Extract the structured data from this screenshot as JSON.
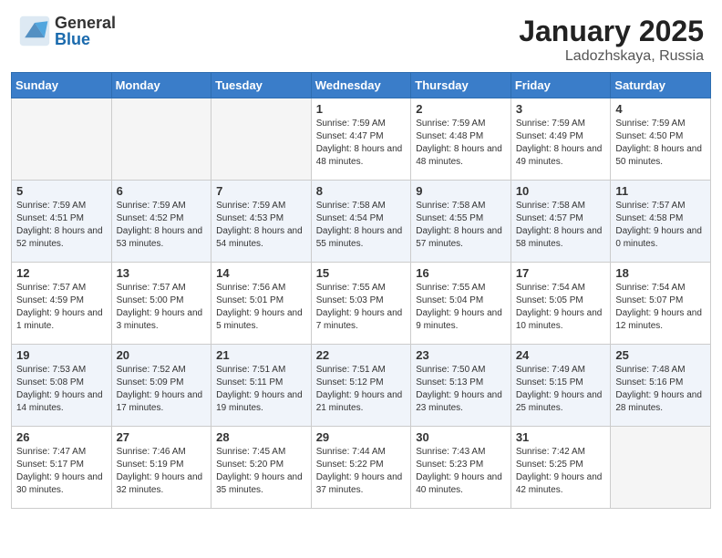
{
  "logo": {
    "general": "General",
    "blue": "Blue"
  },
  "header": {
    "month": "January 2025",
    "location": "Ladozhskaya, Russia"
  },
  "weekdays": [
    "Sunday",
    "Monday",
    "Tuesday",
    "Wednesday",
    "Thursday",
    "Friday",
    "Saturday"
  ],
  "weeks": [
    [
      {
        "day": "",
        "empty": true
      },
      {
        "day": "",
        "empty": true
      },
      {
        "day": "",
        "empty": true
      },
      {
        "day": "1",
        "sunrise": "7:59 AM",
        "sunset": "4:47 PM",
        "daylight": "8 hours and 48 minutes."
      },
      {
        "day": "2",
        "sunrise": "7:59 AM",
        "sunset": "4:48 PM",
        "daylight": "8 hours and 48 minutes."
      },
      {
        "day": "3",
        "sunrise": "7:59 AM",
        "sunset": "4:49 PM",
        "daylight": "8 hours and 49 minutes."
      },
      {
        "day": "4",
        "sunrise": "7:59 AM",
        "sunset": "4:50 PM",
        "daylight": "8 hours and 50 minutes."
      }
    ],
    [
      {
        "day": "5",
        "sunrise": "7:59 AM",
        "sunset": "4:51 PM",
        "daylight": "8 hours and 52 minutes."
      },
      {
        "day": "6",
        "sunrise": "7:59 AM",
        "sunset": "4:52 PM",
        "daylight": "8 hours and 53 minutes."
      },
      {
        "day": "7",
        "sunrise": "7:59 AM",
        "sunset": "4:53 PM",
        "daylight": "8 hours and 54 minutes."
      },
      {
        "day": "8",
        "sunrise": "7:58 AM",
        "sunset": "4:54 PM",
        "daylight": "8 hours and 55 minutes."
      },
      {
        "day": "9",
        "sunrise": "7:58 AM",
        "sunset": "4:55 PM",
        "daylight": "8 hours and 57 minutes."
      },
      {
        "day": "10",
        "sunrise": "7:58 AM",
        "sunset": "4:57 PM",
        "daylight": "8 hours and 58 minutes."
      },
      {
        "day": "11",
        "sunrise": "7:57 AM",
        "sunset": "4:58 PM",
        "daylight": "9 hours and 0 minutes."
      }
    ],
    [
      {
        "day": "12",
        "sunrise": "7:57 AM",
        "sunset": "4:59 PM",
        "daylight": "9 hours and 1 minute."
      },
      {
        "day": "13",
        "sunrise": "7:57 AM",
        "sunset": "5:00 PM",
        "daylight": "9 hours and 3 minutes."
      },
      {
        "day": "14",
        "sunrise": "7:56 AM",
        "sunset": "5:01 PM",
        "daylight": "9 hours and 5 minutes."
      },
      {
        "day": "15",
        "sunrise": "7:55 AM",
        "sunset": "5:03 PM",
        "daylight": "9 hours and 7 minutes."
      },
      {
        "day": "16",
        "sunrise": "7:55 AM",
        "sunset": "5:04 PM",
        "daylight": "9 hours and 9 minutes."
      },
      {
        "day": "17",
        "sunrise": "7:54 AM",
        "sunset": "5:05 PM",
        "daylight": "9 hours and 10 minutes."
      },
      {
        "day": "18",
        "sunrise": "7:54 AM",
        "sunset": "5:07 PM",
        "daylight": "9 hours and 12 minutes."
      }
    ],
    [
      {
        "day": "19",
        "sunrise": "7:53 AM",
        "sunset": "5:08 PM",
        "daylight": "9 hours and 14 minutes."
      },
      {
        "day": "20",
        "sunrise": "7:52 AM",
        "sunset": "5:09 PM",
        "daylight": "9 hours and 17 minutes."
      },
      {
        "day": "21",
        "sunrise": "7:51 AM",
        "sunset": "5:11 PM",
        "daylight": "9 hours and 19 minutes."
      },
      {
        "day": "22",
        "sunrise": "7:51 AM",
        "sunset": "5:12 PM",
        "daylight": "9 hours and 21 minutes."
      },
      {
        "day": "23",
        "sunrise": "7:50 AM",
        "sunset": "5:13 PM",
        "daylight": "9 hours and 23 minutes."
      },
      {
        "day": "24",
        "sunrise": "7:49 AM",
        "sunset": "5:15 PM",
        "daylight": "9 hours and 25 minutes."
      },
      {
        "day": "25",
        "sunrise": "7:48 AM",
        "sunset": "5:16 PM",
        "daylight": "9 hours and 28 minutes."
      }
    ],
    [
      {
        "day": "26",
        "sunrise": "7:47 AM",
        "sunset": "5:17 PM",
        "daylight": "9 hours and 30 minutes."
      },
      {
        "day": "27",
        "sunrise": "7:46 AM",
        "sunset": "5:19 PM",
        "daylight": "9 hours and 32 minutes."
      },
      {
        "day": "28",
        "sunrise": "7:45 AM",
        "sunset": "5:20 PM",
        "daylight": "9 hours and 35 minutes."
      },
      {
        "day": "29",
        "sunrise": "7:44 AM",
        "sunset": "5:22 PM",
        "daylight": "9 hours and 37 minutes."
      },
      {
        "day": "30",
        "sunrise": "7:43 AM",
        "sunset": "5:23 PM",
        "daylight": "9 hours and 40 minutes."
      },
      {
        "day": "31",
        "sunrise": "7:42 AM",
        "sunset": "5:25 PM",
        "daylight": "9 hours and 42 minutes."
      },
      {
        "day": "",
        "empty": true
      }
    ]
  ]
}
